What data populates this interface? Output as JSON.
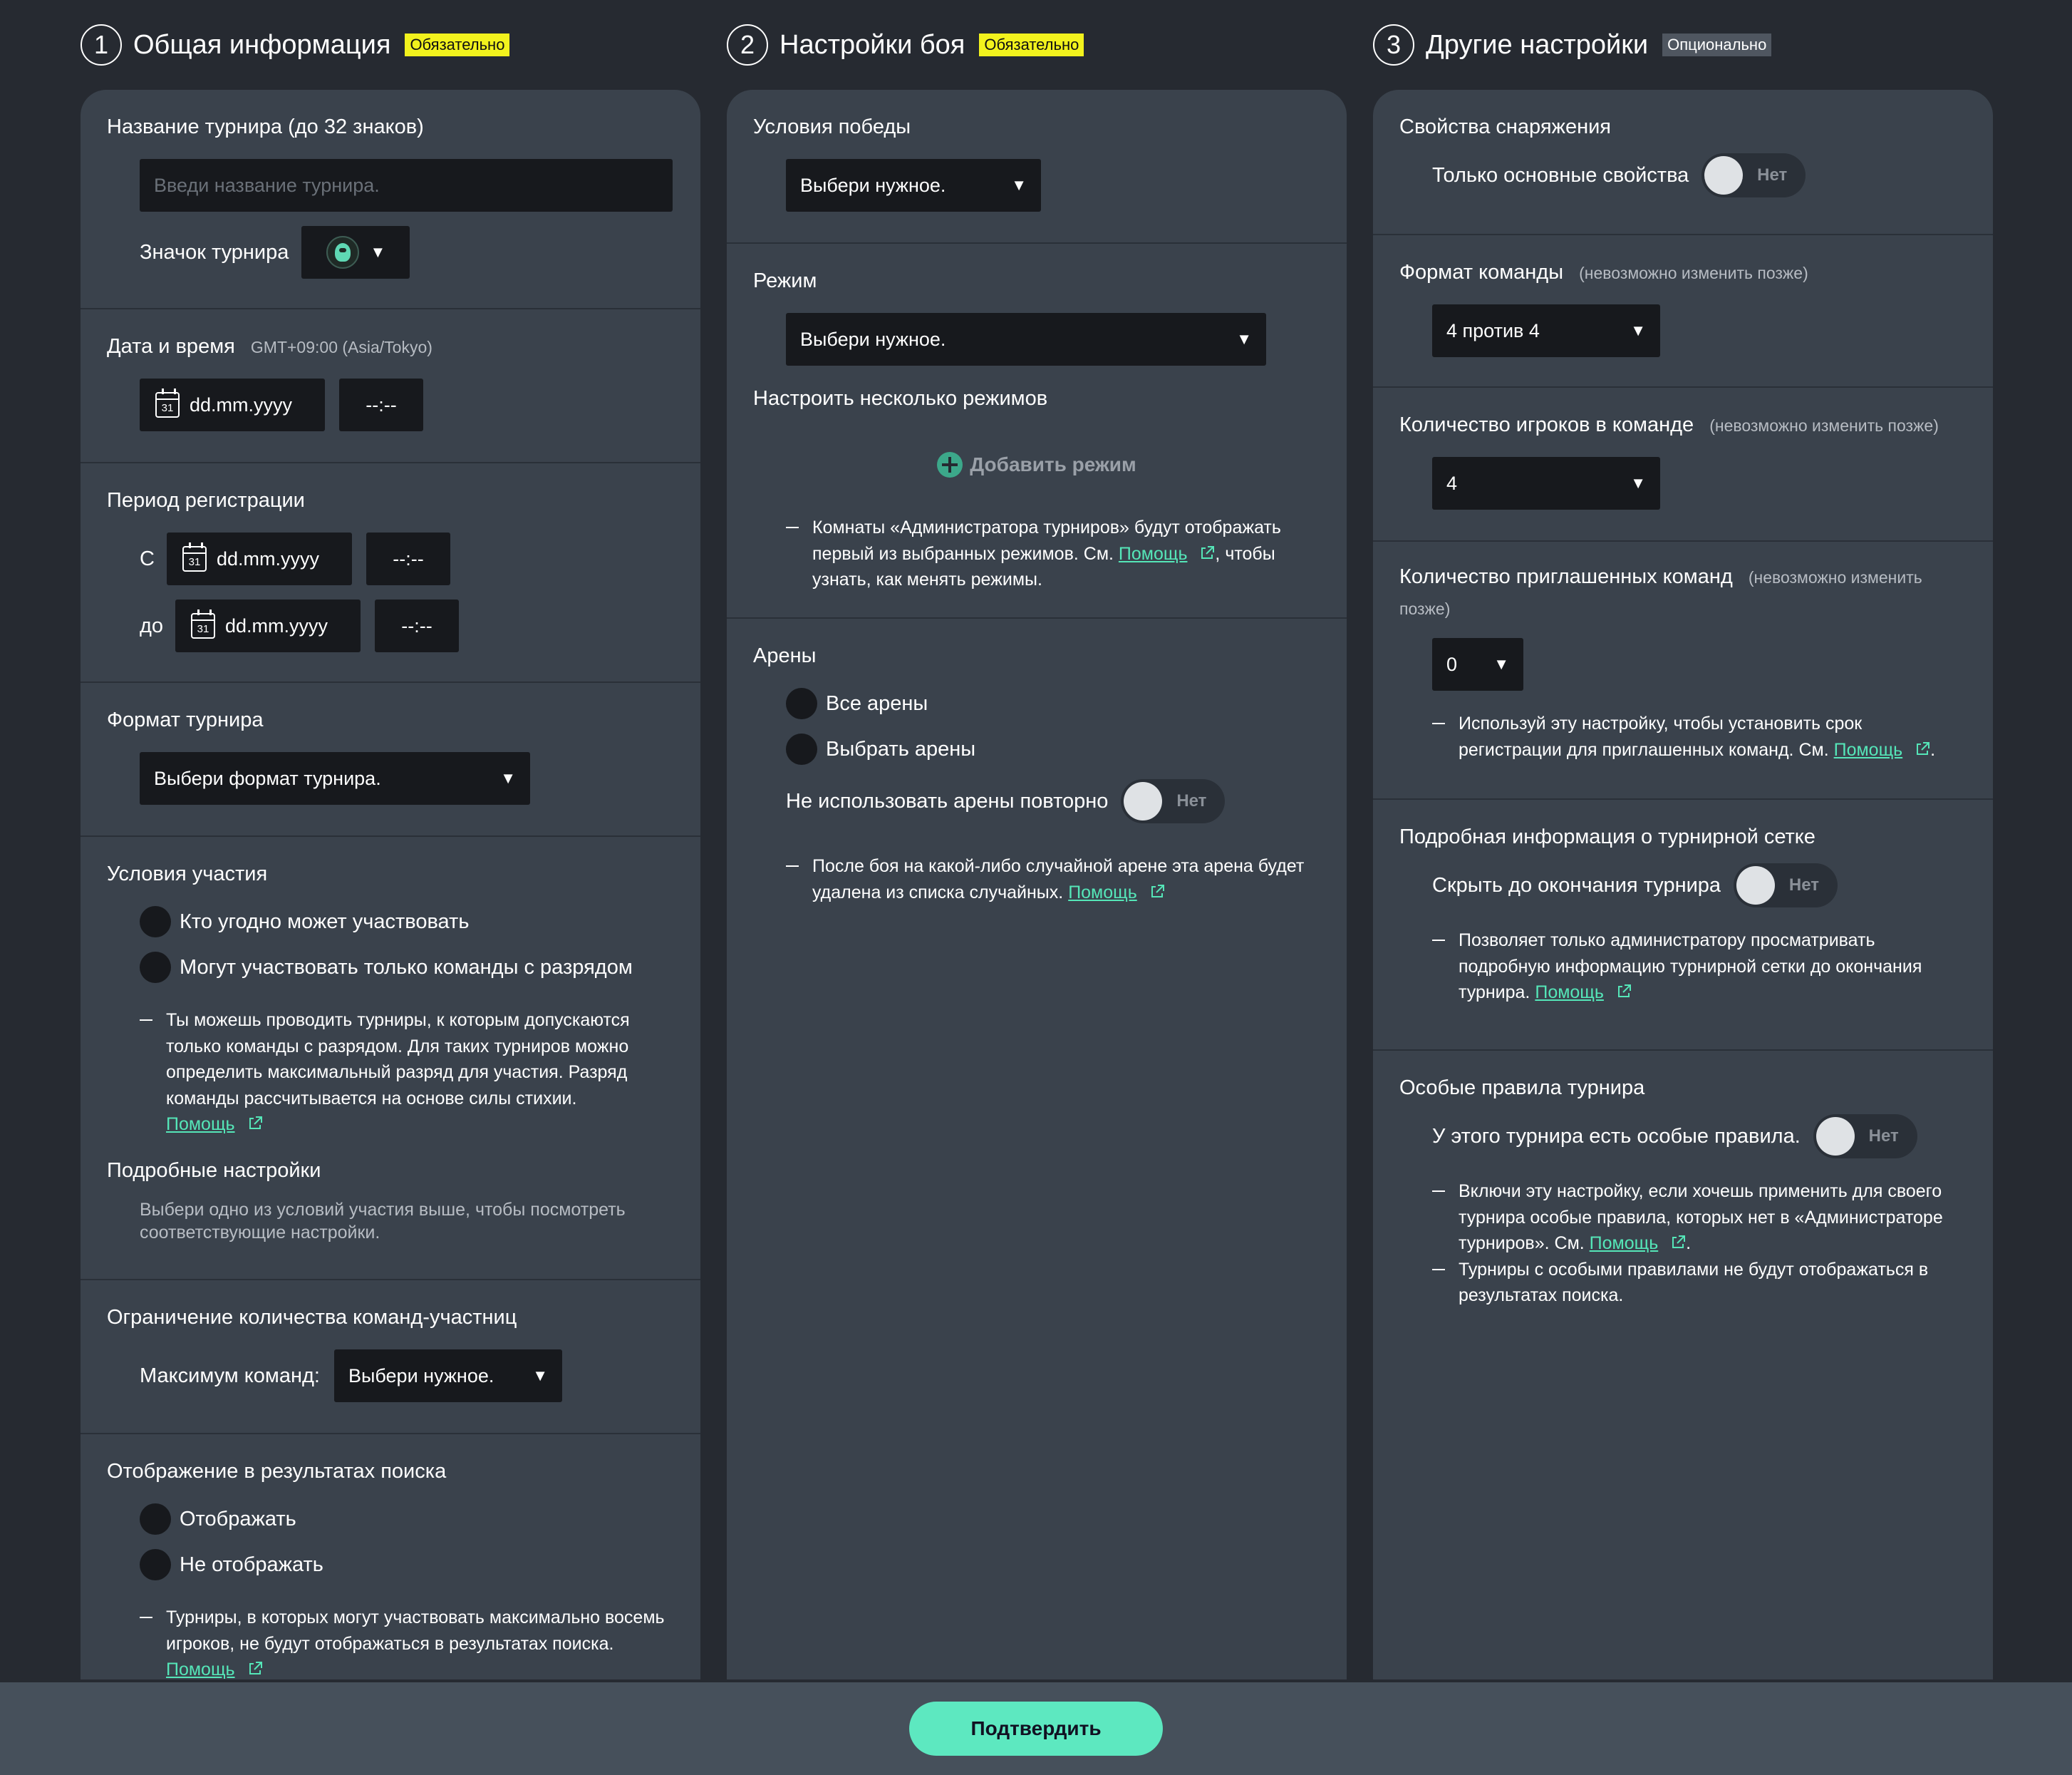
{
  "columns": [
    {
      "num": "1",
      "title": "Общая информация",
      "tag": "Обязательно"
    },
    {
      "num": "2",
      "title": "Настройки боя",
      "tag": "Обязательно"
    },
    {
      "num": "3",
      "title": "Другие настройки",
      "tag": "Опционально"
    }
  ],
  "general": {
    "name": {
      "title": "Название турнира (до 32 знаков)",
      "placeholder": "Введи название турнира."
    },
    "icon": {
      "label": "Значок турнира",
      "icon_name": "tournament-emblem-icon"
    },
    "datetime": {
      "title": "Дата и время",
      "tz": "GMT+09:00 (Asia/Tokyo)",
      "date": "dd.mm.yyyy",
      "time": "--:--",
      "cal_day": "31"
    },
    "registration": {
      "title": "Период регистрации",
      "from_label": "С",
      "to_label": "до",
      "date": "dd.mm.yyyy",
      "time": "--:--"
    },
    "format": {
      "title": "Формат турнира",
      "value": "Выбери формат турнира."
    },
    "participation": {
      "title": "Условия участия",
      "options": [
        "Кто угодно может участвовать",
        "Могут участвовать только команды с разрядом"
      ],
      "note": "Ты можешь проводить турниры, к которым допускаются только команды с разрядом. Для таких турниров можно определить максимальный разряд для участия. Разряд команды рассчитывается на основе силы стихии.",
      "help": "Помощь"
    },
    "details": {
      "title": "Подробные настройки",
      "hint": "Выбери одно из условий участия выше, чтобы посмотреть соответствующие настройки."
    },
    "limit": {
      "title": "Ограничение количества команд-участниц",
      "label": "Максимум команд:",
      "value": "Выбери нужное."
    },
    "search": {
      "title": "Отображение в результатах поиска",
      "options": [
        "Отображать",
        "Не отображать"
      ],
      "note": "Турниры, в которых могут участвовать максимально восемь игроков, не будут отображаться в результатах поиска.",
      "help": "Помощь"
    }
  },
  "battle": {
    "win": {
      "title": "Условия победы",
      "value": "Выбери нужное."
    },
    "mode": {
      "title": "Режим",
      "value": "Выбери нужное.",
      "multi_title": "Настроить несколько режимов",
      "add_label": "Добавить режим",
      "note_a": "Комнаты «Администратора турниров» будут отображать первый из выбранных режимов. См.",
      "help": "Помощь",
      "note_b": ", чтобы узнать, как менять режимы."
    },
    "arenas": {
      "title": "Арены",
      "options": [
        "Все арены",
        "Выбрать арены"
      ],
      "no_repeat_label": "Не использовать арены повторно",
      "toggle": "Нет",
      "note": "После боя на какой-либо случайной арене эта арена будет удалена из списка случайных.",
      "help": "Помощь"
    }
  },
  "other": {
    "equipment": {
      "title": "Свойства снаряжения",
      "label": "Только основные свойства",
      "toggle": "Нет"
    },
    "team_format": {
      "title": "Формат команды",
      "note": "(невозможно изменить позже)",
      "value": "4 против 4"
    },
    "players": {
      "title": "Количество игроков в команде",
      "note": "(невозможно изменить позже)",
      "value": "4"
    },
    "invited": {
      "title": "Количество приглашенных команд",
      "note": "(невозможно изменить позже)",
      "value": "0",
      "hint": "Используй эту настройку, чтобы установить срок регистрации для приглашенных команд. См.",
      "help": "Помощь",
      "hint_end": "."
    },
    "bracket": {
      "title": "Подробная информация о турнирной сетке",
      "label": "Скрыть до окончания турнира",
      "toggle": "Нет",
      "note": "Позволяет только администратору просматривать подробную информацию турнирной сетки до окончания турнира.",
      "help": "Помощь"
    },
    "special": {
      "title": "Особые правила турнира",
      "label": "У этого турнира есть особые правила.",
      "toggle": "Нет",
      "note1": "Включи эту настройку, если хочешь применить для своего турнира особые правила, которых нет в «Администраторе турниров». См.",
      "help": "Помощь",
      "note1_end": ".",
      "note2": "Турниры с особыми правилами не будут отображаться в результатах поиска."
    }
  },
  "footer": {
    "confirm": "Подтвердить"
  },
  "icons": {
    "dropdown": "▼"
  },
  "colors": {
    "accent": "#55e6b8",
    "required_tag": "#f2f21d",
    "panel": "#3a424c",
    "background": "#262a31",
    "confirm": "#5de8c0"
  }
}
